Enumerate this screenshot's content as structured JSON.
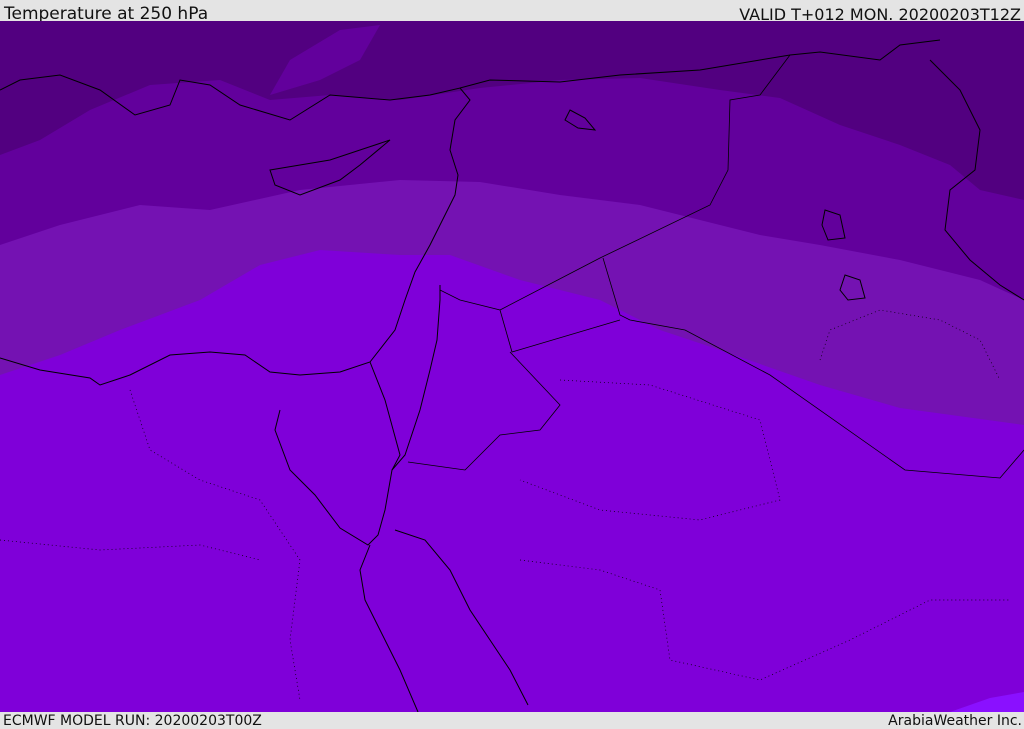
{
  "header": {
    "title": "Temperature at 250 hPa",
    "valid": "VALID T+012 MON. 20200203T12Z"
  },
  "footer": {
    "model_run": "ECMWF MODEL RUN: 20200203T00Z",
    "credit": "ArabiaWeather Inc."
  },
  "colors": {
    "band1": "#520080",
    "band2": "#62009c",
    "band3": "#7412b2",
    "band4": "#7f00d9",
    "band5": "#8a10ff",
    "coast": "#000000"
  }
}
